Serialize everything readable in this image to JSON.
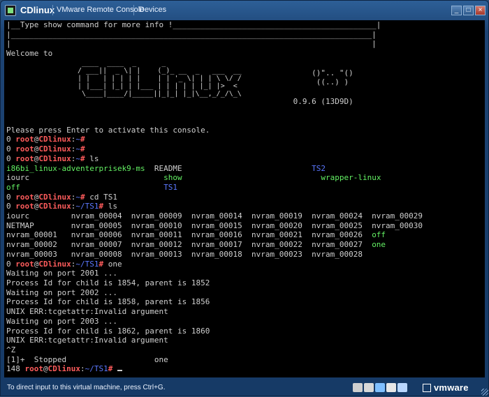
{
  "window": {
    "title": "CDlinux",
    "menus": [
      "VMware Remote Console",
      "Devices"
    ],
    "controls": [
      "minimize",
      "maximize",
      "close"
    ]
  },
  "console": {
    "lines": [
      [
        {
          "t": "|__Type show command for more info !____________________________________________|",
          "c": "w"
        }
      ],
      [
        {
          "t": "|______________________________________________________________________________|",
          "c": "w"
        }
      ],
      [
        {
          "t": "|                                                                              |",
          "c": "w"
        }
      ],
      [
        {
          "t": "Welcome to",
          "c": "w"
        }
      ],
      [
        {
          "t": " ",
          "c": "w"
        }
      ],
      [
        {
          "t": "                                                                  ()\".. \"()",
          "c": "w"
        }
      ],
      [
        {
          "t": "                                                                   ((..) )",
          "c": "w"
        }
      ],
      [
        {
          "t": " ",
          "c": "w"
        }
      ],
      [
        {
          "t": "                                                              0.9.6 (13D9D)",
          "c": "w"
        }
      ],
      [
        {
          "t": " ",
          "c": "w"
        }
      ],
      [
        {
          "t": " ",
          "c": "w"
        }
      ],
      [
        {
          "t": "Please press Enter to activate this console.",
          "c": "w"
        }
      ],
      [
        {
          "t": "0 ",
          "c": "w"
        },
        {
          "t": "root",
          "c": "r"
        },
        {
          "t": "@",
          "c": "w"
        },
        {
          "t": "CDlinux",
          "c": "r"
        },
        {
          "t": ":",
          "c": "w"
        },
        {
          "t": "~",
          "c": "b"
        },
        {
          "t": "# ",
          "c": "r"
        }
      ],
      [
        {
          "t": "0 ",
          "c": "w"
        },
        {
          "t": "root",
          "c": "r"
        },
        {
          "t": "@",
          "c": "w"
        },
        {
          "t": "CDlinux",
          "c": "r"
        },
        {
          "t": ":",
          "c": "w"
        },
        {
          "t": "~",
          "c": "b"
        },
        {
          "t": "# ",
          "c": "r"
        }
      ],
      [
        {
          "t": "0 ",
          "c": "w"
        },
        {
          "t": "root",
          "c": "r"
        },
        {
          "t": "@",
          "c": "w"
        },
        {
          "t": "CDlinux",
          "c": "r"
        },
        {
          "t": ":",
          "c": "w"
        },
        {
          "t": "~",
          "c": "b"
        },
        {
          "t": "# ",
          "c": "r"
        },
        {
          "t": "ls",
          "c": "w"
        }
      ],
      [
        {
          "t": "i86bi_linux-adventerprisek9-ms",
          "c": "g"
        },
        {
          "t": "  README                            ",
          "c": "w"
        },
        {
          "t": "TS2",
          "c": "b"
        }
      ],
      [
        {
          "t": "iourc                             ",
          "c": "w"
        },
        {
          "t": "show",
          "c": "g"
        },
        {
          "t": "                              ",
          "c": "w"
        },
        {
          "t": "wrapper-linux",
          "c": "g"
        }
      ],
      [
        {
          "t": "off",
          "c": "g"
        },
        {
          "t": "                               ",
          "c": "w"
        },
        {
          "t": "TS1",
          "c": "b"
        }
      ],
      [
        {
          "t": "0 ",
          "c": "w"
        },
        {
          "t": "root",
          "c": "r"
        },
        {
          "t": "@",
          "c": "w"
        },
        {
          "t": "CDlinux",
          "c": "r"
        },
        {
          "t": ":",
          "c": "w"
        },
        {
          "t": "~",
          "c": "b"
        },
        {
          "t": "# ",
          "c": "r"
        },
        {
          "t": "cd TS1",
          "c": "w"
        }
      ],
      [
        {
          "t": "0 ",
          "c": "w"
        },
        {
          "t": "root",
          "c": "r"
        },
        {
          "t": "@",
          "c": "w"
        },
        {
          "t": "CDlinux",
          "c": "r"
        },
        {
          "t": ":",
          "c": "w"
        },
        {
          "t": "~/TS1",
          "c": "b"
        },
        {
          "t": "# ",
          "c": "r"
        },
        {
          "t": "ls",
          "c": "w"
        }
      ],
      [
        {
          "t": "iourc         nvram_00004  nvram_00009  nvram_00014  nvram_00019  nvram_00024  nvram_00029",
          "c": "w"
        }
      ],
      [
        {
          "t": "NETMAP        nvram_00005  nvram_00010  nvram_00015  nvram_00020  nvram_00025  nvram_00030",
          "c": "w"
        }
      ],
      [
        {
          "t": "nvram_00001   nvram_00006  nvram_00011  nvram_00016  nvram_00021  nvram_00026  ",
          "c": "w"
        },
        {
          "t": "off",
          "c": "g"
        }
      ],
      [
        {
          "t": "nvram_00002   nvram_00007  nvram_00012  nvram_00017  nvram_00022  nvram_00027  ",
          "c": "w"
        },
        {
          "t": "one",
          "c": "g"
        }
      ],
      [
        {
          "t": "nvram_00003   nvram_00008  nvram_00013  nvram_00018  nvram_00023  nvram_00028",
          "c": "w"
        }
      ],
      [
        {
          "t": "0 ",
          "c": "w"
        },
        {
          "t": "root",
          "c": "r"
        },
        {
          "t": "@",
          "c": "w"
        },
        {
          "t": "CDlinux",
          "c": "r"
        },
        {
          "t": ":",
          "c": "w"
        },
        {
          "t": "~/TS1",
          "c": "b"
        },
        {
          "t": "# ",
          "c": "r"
        },
        {
          "t": "one",
          "c": "w"
        }
      ],
      [
        {
          "t": "Waiting on port 2001 ...",
          "c": "w"
        }
      ],
      [
        {
          "t": "Process Id for child is 1854, parent is 1852",
          "c": "w"
        }
      ],
      [
        {
          "t": "Waiting on port 2002 ...",
          "c": "w"
        }
      ],
      [
        {
          "t": "Process Id for child is 1858, parent is 1856",
          "c": "w"
        }
      ],
      [
        {
          "t": "UNIX ERR:tcgetattr:Invalid argument",
          "c": "w"
        }
      ],
      [
        {
          "t": "Waiting on port 2003 ...",
          "c": "w"
        }
      ],
      [
        {
          "t": "Process Id for child is 1862, parent is 1860",
          "c": "w"
        }
      ],
      [
        {
          "t": "UNIX ERR:tcgetattr:Invalid argument",
          "c": "w"
        }
      ],
      [
        {
          "t": "^Z",
          "c": "w"
        }
      ],
      [
        {
          "t": "[1]+  Stopped                   one",
          "c": "w"
        }
      ],
      [
        {
          "t": "148 ",
          "c": "w"
        },
        {
          "t": "root",
          "c": "r"
        },
        {
          "t": "@",
          "c": "w"
        },
        {
          "t": "CDlinux",
          "c": "r"
        },
        {
          "t": ":",
          "c": "w"
        },
        {
          "t": "~/TS1",
          "c": "b"
        },
        {
          "t": "# ",
          "c": "r"
        }
      ]
    ],
    "ascii_logo": " ____  ____  _      _\n/ ___||  _ \\| |    (_)_ __  _   ___  __\n| |   | | | | |    | | '_ \\| | | \\ \\/ /\n| |___| |_| | |___ | | | | | |_| |>  <\n \\____|____/|_____||_|_| |_|\\__,_/_/\\_\\"
  },
  "statusbar": {
    "text": "To direct input to this virtual machine, press Ctrl+G.",
    "brand": "vmware"
  },
  "colors": {
    "prompt_red": "#ff5c5c",
    "dir_blue": "#5b78ff",
    "exec_green": "#63f063"
  }
}
